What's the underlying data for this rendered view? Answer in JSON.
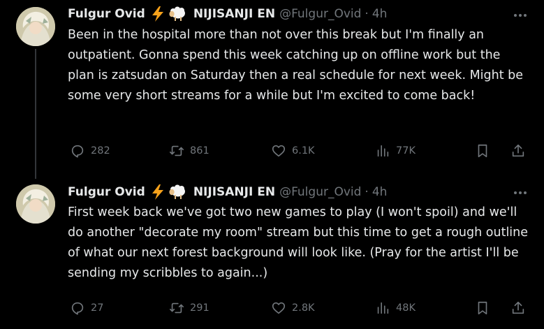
{
  "tweets": [
    {
      "author_name": "Fulgur Ovid",
      "affiliation": "NIJISANJI EN",
      "handle": "@Fulgur_Ovid",
      "time": "4h",
      "text": "Been in the hospital more than not over this break but I'm finally an outpatient. Gonna spend this week catching up on offline work but the plan is zatsudan on Saturday then a real schedule for next week. Might be some very short streams for a while but I'm excited to come back!",
      "replies": "282",
      "reposts": "861",
      "likes": "6.1K",
      "views": "77K"
    },
    {
      "author_name": "Fulgur Ovid",
      "affiliation": "NIJISANJI EN",
      "handle": "@Fulgur_Ovid",
      "time": "4h",
      "text": "First week back we've got two new games to play (I won't spoil) and we'll do another \"decorate my room\" stream but this time to get a rough outline of what our next forest background will look like. (Pray for the artist I'll be sending my scribbles to again...)",
      "replies": "27",
      "reposts": "291",
      "likes": "2.8K",
      "views": "48K"
    }
  ],
  "separator": "·",
  "icons": {
    "emoji": [
      "lightning-bolt-emoji",
      "sheep-emoji"
    ],
    "more": "more-dots-icon",
    "actions": [
      "reply-icon",
      "repost-icon",
      "like-icon",
      "views-icon",
      "bookmark-icon",
      "share-icon"
    ]
  },
  "colors": {
    "background": "#000000",
    "text": "#e7e9ea",
    "muted": "#71767b",
    "thread_line": "#333639",
    "bolt": "#f7a21b"
  }
}
